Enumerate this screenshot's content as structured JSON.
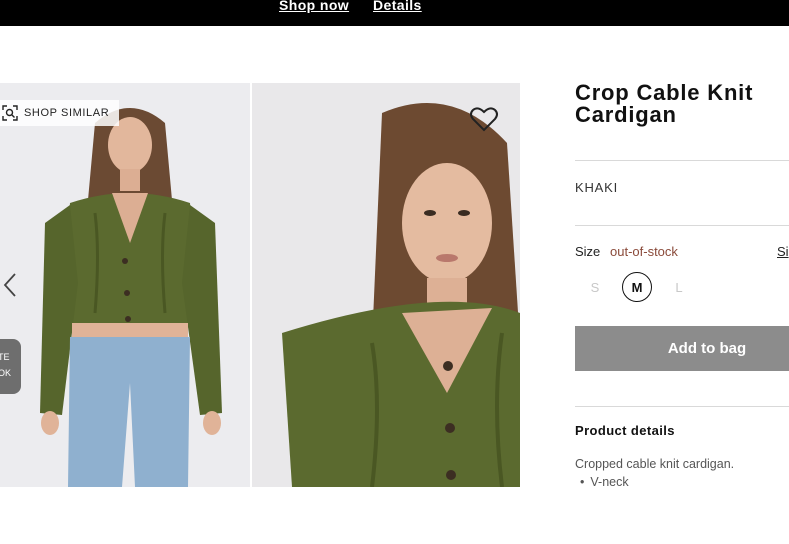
{
  "top_banner": {
    "shop_now": "Shop now",
    "details": "Details"
  },
  "gallery": {
    "shop_similar": "SHOP SIMILAR",
    "complete_look_line1": "TE",
    "complete_look_line2": "OK"
  },
  "product": {
    "title": "Crop Cable Knit Cardigan",
    "color": "KHAKI",
    "size_label": "Size",
    "size_status": "out-of-stock",
    "size_guide": "Si",
    "sizes": [
      {
        "label": "S",
        "selected": false
      },
      {
        "label": "M",
        "selected": true
      },
      {
        "label": "L",
        "selected": false
      }
    ],
    "add_to_bag": "Add to bag",
    "details_heading": "Product details",
    "details_description": "Cropped cable knit cardigan.",
    "details_bullets": [
      "V-neck"
    ]
  },
  "colors": {
    "sweater": "#5b6a2f",
    "button_disabled": "#8c8c8c",
    "stock_status": "#8a4a3a"
  }
}
